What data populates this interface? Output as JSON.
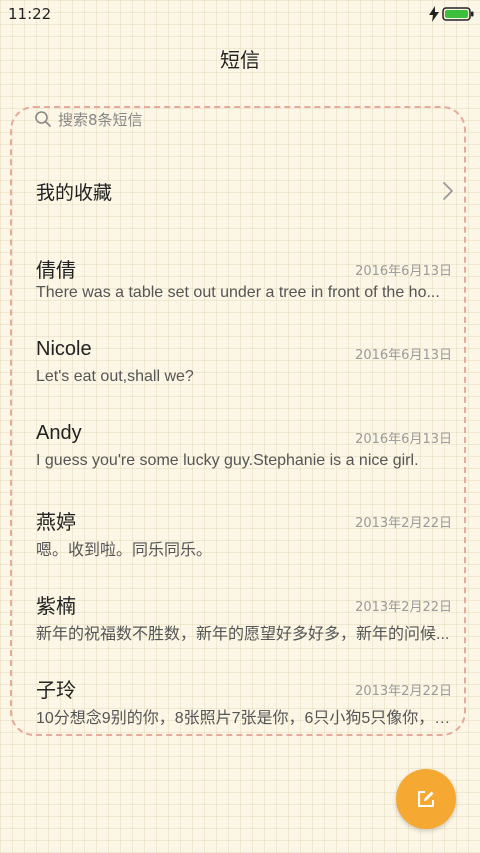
{
  "status_bar": {
    "time": "11:22"
  },
  "header": {
    "title": "短信"
  },
  "search": {
    "placeholder": "搜索8条短信"
  },
  "favorites": {
    "label": "我的收藏"
  },
  "conversations": [
    {
      "name": "倩倩",
      "date": "2016年6月13日",
      "preview": "There was a table set out under a tree in front of the ho..."
    },
    {
      "name": "Nicole",
      "date": "2016年6月13日",
      "preview": "Let's eat out,shall we?"
    },
    {
      "name": "Andy",
      "date": "2016年6月13日",
      "preview": "I guess you're some lucky guy.Stephanie is a nice girl."
    },
    {
      "name": "燕婷",
      "date": "2013年2月22日",
      "preview": "嗯。收到啦。同乐同乐。"
    },
    {
      "name": "紫楠",
      "date": "2013年2月22日",
      "preview": "新年的祝福数不胜数，新年的愿望好多好多，新年的问候..."
    },
    {
      "name": "子玲",
      "date": "2013年2月22日",
      "preview": "10分想念9别的你，8张照片7张是你，6只小狗5只像你，4..."
    }
  ],
  "colors": {
    "fab": "#f5a832",
    "battery": "#3cbf3c",
    "panel_border": "#e7a99a"
  },
  "icons": {
    "search": "search-icon",
    "chevron": "chevron-right-icon",
    "compose": "compose-icon",
    "battery": "battery-icon",
    "charging": "bolt-icon"
  }
}
